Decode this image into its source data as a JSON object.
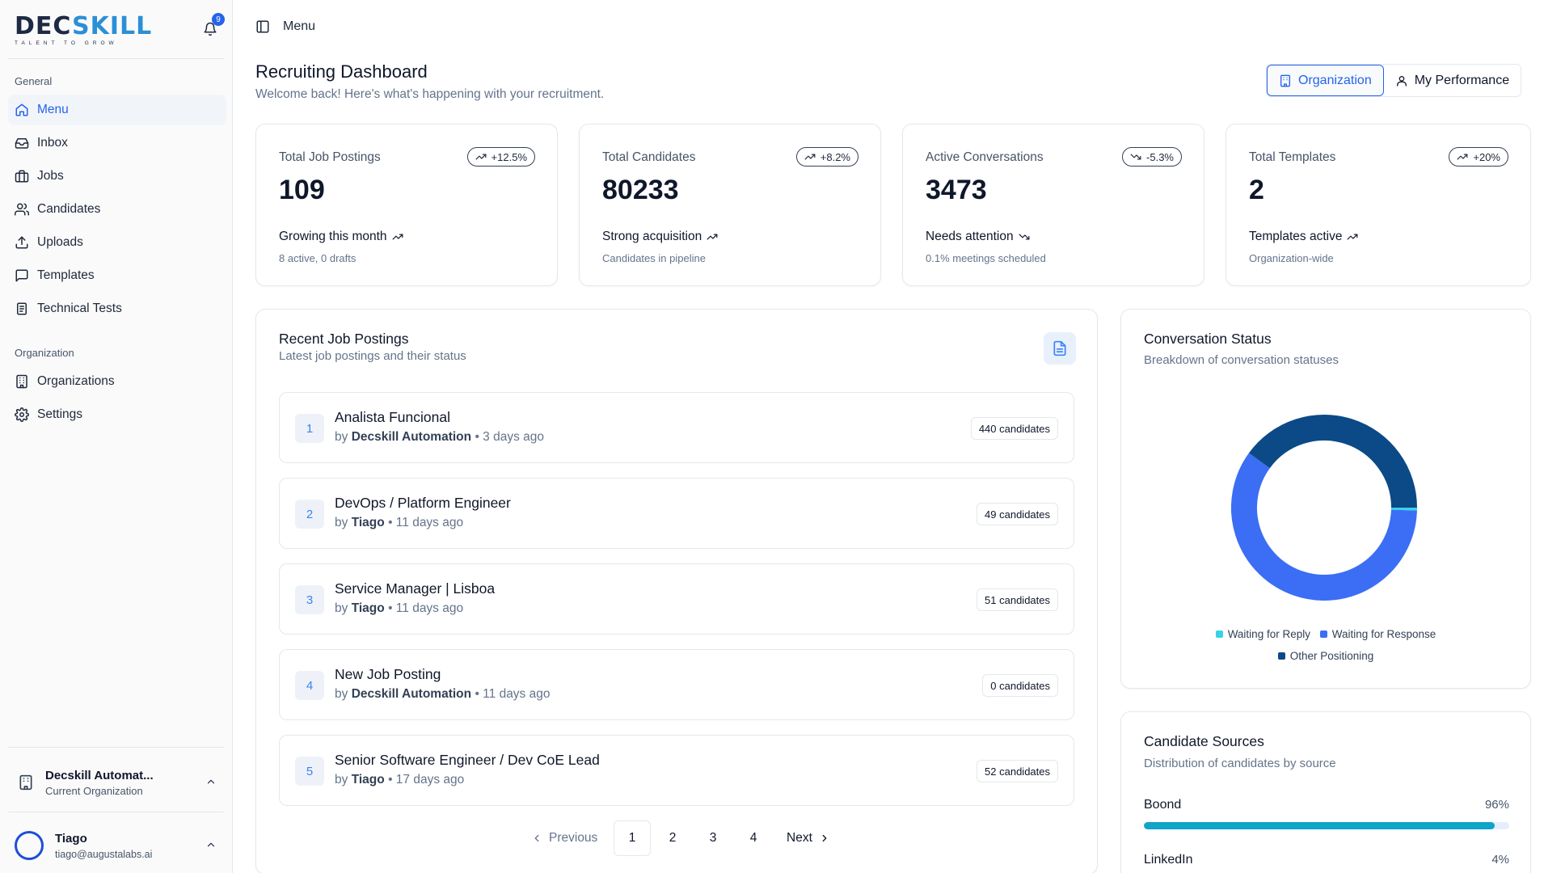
{
  "brand": {
    "logo_main": "DECSKILL",
    "logo_tagline": "TALENT TO GROW"
  },
  "notifications": {
    "count": "9"
  },
  "sidebar": {
    "general_label": "General",
    "general_items": [
      {
        "label": "Menu",
        "icon": "home-icon",
        "active": true
      },
      {
        "label": "Inbox",
        "icon": "inbox-icon"
      },
      {
        "label": "Jobs",
        "icon": "briefcase-icon"
      },
      {
        "label": "Candidates",
        "icon": "users-icon"
      },
      {
        "label": "Uploads",
        "icon": "upload-icon"
      },
      {
        "label": "Templates",
        "icon": "message-square-icon"
      },
      {
        "label": "Technical Tests",
        "icon": "clipboard-icon"
      }
    ],
    "org_label": "Organization",
    "org_items": [
      {
        "label": "Organizations",
        "icon": "building-icon"
      },
      {
        "label": "Settings",
        "icon": "gear-icon"
      }
    ],
    "org_switcher": {
      "title": "Decskill Automat...",
      "subtitle": "Current Organization"
    },
    "user": {
      "name": "Tiago",
      "email": "tiago@augustalabs.ai"
    }
  },
  "topbar": {
    "menu_label": "Menu"
  },
  "header": {
    "title": "Recruiting Dashboard",
    "subtitle": "Welcome back! Here's what's happening with your recruitment.",
    "toggle": {
      "organization": "Organization",
      "my_performance": "My Performance"
    }
  },
  "stats": [
    {
      "label": "Total Job Postings",
      "badge": "+12.5%",
      "trend": "up",
      "value": "109",
      "note": "Growing this month",
      "sub": "8 active, 0 drafts"
    },
    {
      "label": "Total Candidates",
      "badge": "+8.2%",
      "trend": "up",
      "value": "80233",
      "note": "Strong acquisition",
      "sub": "Candidates in pipeline"
    },
    {
      "label": "Active Conversations",
      "badge": "-5.3%",
      "trend": "down",
      "value": "3473",
      "note": "Needs attention",
      "sub": "0.1% meetings scheduled"
    },
    {
      "label": "Total Templates",
      "badge": "+20%",
      "trend": "up",
      "value": "2",
      "note": "Templates active",
      "sub": "Organization-wide"
    }
  ],
  "recent_jobs": {
    "title": "Recent Job Postings",
    "subtitle": "Latest job postings and their status",
    "items": [
      {
        "num": "1",
        "title": "Analista Funcional",
        "by_prefix": "by",
        "author": "Decskill Automation",
        "age": "• 3 days ago",
        "candidates": "440 candidates"
      },
      {
        "num": "2",
        "title": "DevOps / Platform Engineer",
        "by_prefix": "by",
        "author": "Tiago",
        "age": "• 11 days ago",
        "candidates": "49 candidates"
      },
      {
        "num": "3",
        "title": "Service Manager | Lisboa",
        "by_prefix": "by",
        "author": "Tiago",
        "age": "• 11 days ago",
        "candidates": "51 candidates"
      },
      {
        "num": "4",
        "title": "New Job Posting",
        "by_prefix": "by",
        "author": "Decskill Automation",
        "age": "• 11 days ago",
        "candidates": "0 candidates"
      },
      {
        "num": "5",
        "title": "Senior Software Engineer / Dev CoE Lead",
        "by_prefix": "by",
        "author": "Tiago",
        "age": "• 17 days ago",
        "candidates": "52 candidates"
      }
    ],
    "pagination": {
      "previous": "Previous",
      "pages": [
        "1",
        "2",
        "3",
        "4"
      ],
      "current": "1",
      "next": "Next"
    }
  },
  "conversation_status": {
    "title": "Conversation Status",
    "subtitle": "Breakdown of conversation statuses",
    "chart_data": {
      "type": "pie",
      "categories": [
        "Waiting for Reply",
        "Waiting for Response",
        "Other Positioning"
      ],
      "values": [
        0.5,
        59.5,
        40
      ],
      "colors": [
        "#38d3e8",
        "#3b6ef5",
        "#0b4a86"
      ]
    }
  },
  "candidate_sources": {
    "title": "Candidate Sources",
    "subtitle": "Distribution of candidates by source",
    "items": [
      {
        "name": "Boond",
        "percent_label": "96%",
        "fraction": 0.96
      },
      {
        "name": "LinkedIn",
        "percent_label": "4%",
        "fraction": 0.04
      }
    ]
  },
  "colors": {
    "accent": "#2563eb",
    "bar": "#0ea5c6"
  }
}
